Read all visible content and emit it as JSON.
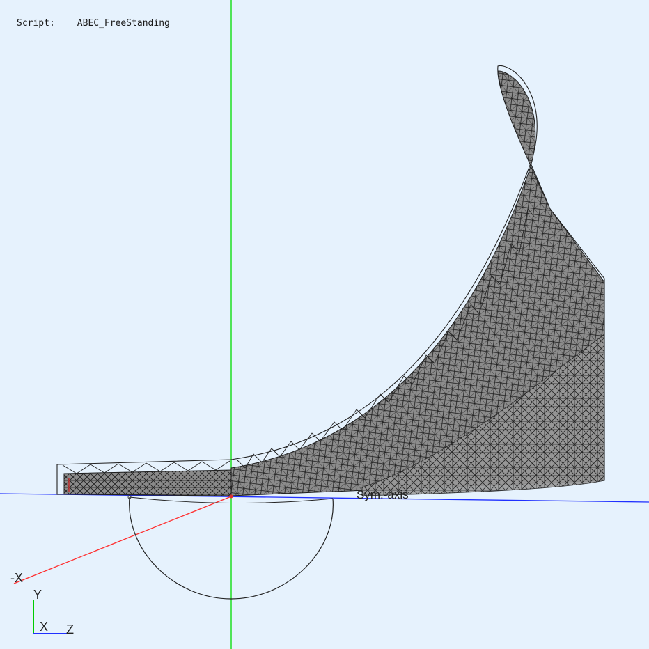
{
  "header": {
    "script_key": "Script:",
    "script_name": "ABEC_FreeStanding"
  },
  "viewport": {
    "background": "#e6f2fd",
    "axis_colors": {
      "x": "#ff3030",
      "y": "#00dd00",
      "z": "#2030ff"
    },
    "mesh_fill": "#8c8c8c",
    "mesh_line": "#1e1e1e",
    "symmetry_axis_label": "Sym.-axis"
  },
  "triad": {
    "neg_x_label": "-X",
    "y_label": "Y",
    "x_label": "X",
    "z_label": "Z"
  }
}
